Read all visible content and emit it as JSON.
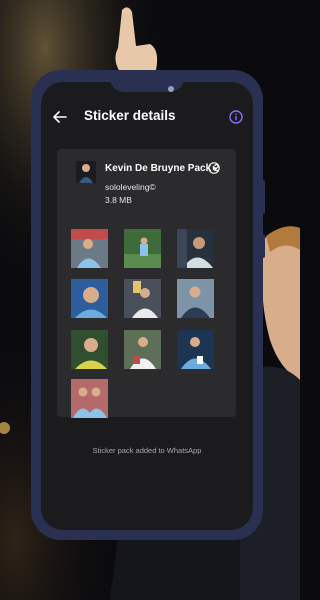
{
  "appbar": {
    "title": "Sticker details"
  },
  "pack": {
    "title": "Kevin De Bruyne Pack 2",
    "publisher": "sololeveling©",
    "size": "3.8 MB",
    "stickers": [
      "sticker-1",
      "sticker-2",
      "sticker-3",
      "sticker-4",
      "sticker-5",
      "sticker-6",
      "sticker-7",
      "sticker-8",
      "sticker-9",
      "sticker-10"
    ]
  },
  "status": {
    "text": "Sticker pack added to WhatsApp"
  },
  "colors": {
    "phone_frame": "#2a3052",
    "screen": "#1b1b1e",
    "card": "#2b2b2e",
    "accent_info": "#8a6cff",
    "city_blue": "#6cabdd"
  },
  "icons": [
    "back-arrow-icon",
    "info-icon",
    "play-icon"
  ]
}
